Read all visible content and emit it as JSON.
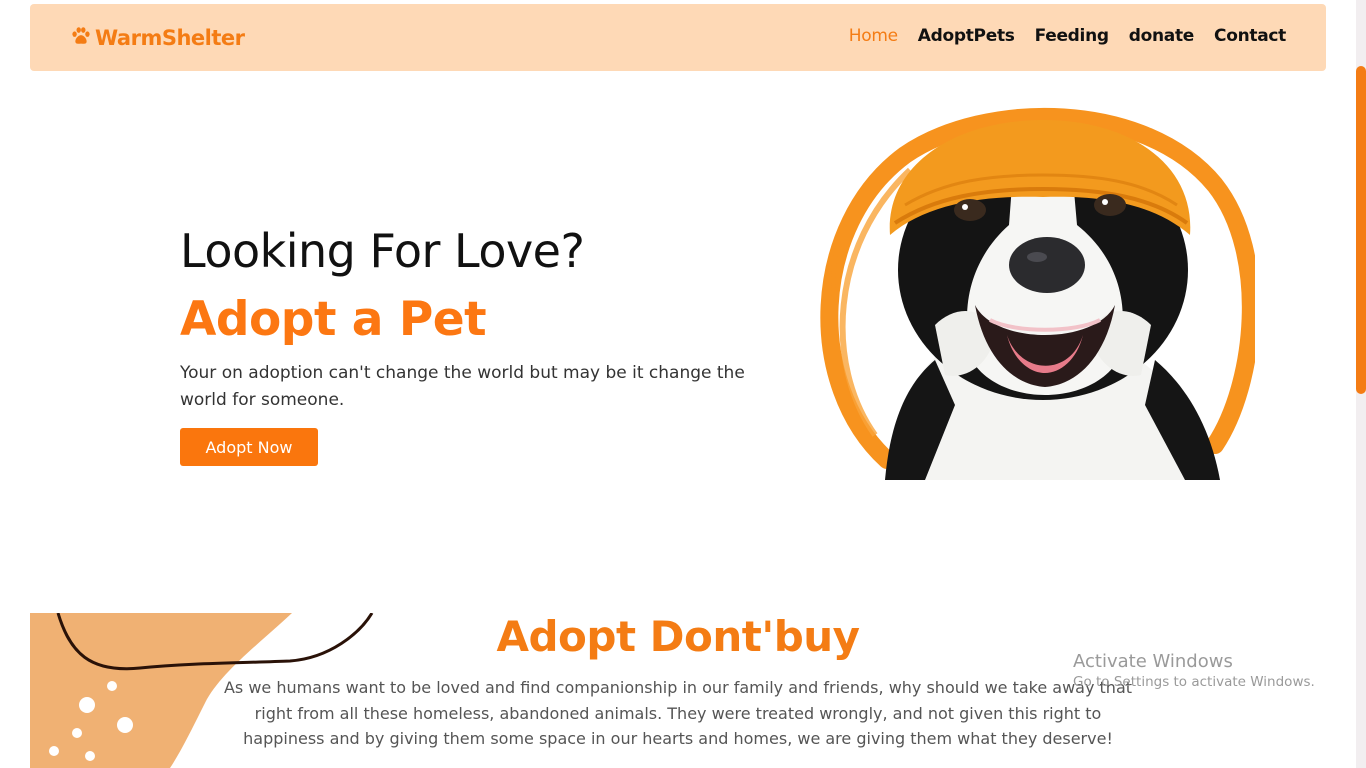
{
  "brand": {
    "name": "WarmShelter",
    "icon": "paw-icon",
    "color": "#f47c14"
  },
  "nav": {
    "items": [
      {
        "label": "Home",
        "active": true
      },
      {
        "label": "AdoptPets",
        "active": false
      },
      {
        "label": "Feeding",
        "active": false
      },
      {
        "label": "donate",
        "active": false
      },
      {
        "label": "Contact",
        "active": false
      }
    ]
  },
  "hero": {
    "title": "Looking For Love?",
    "subtitle": "Adopt a Pet",
    "description": "Your on adoption can't change the world but may be it change the world for someone.",
    "cta_label": "Adopt Now",
    "accent_color": "#fa760d"
  },
  "section": {
    "title": "Adopt Dont'buy",
    "text": "As we humans want to be loved and find companionship in our family and friends, why should we take away that right from all these homeless, abandoned animals. They were treated wrongly, and not given this right to happiness and by giving them some space in our hearts and homes, we are giving them what they deserve!"
  },
  "watermark": {
    "title": "Activate Windows",
    "subtitle": "Go to Settings to activate Windows."
  },
  "colors": {
    "nav_background": "#fed9b6",
    "accent": "#f47c14",
    "blob": "#f0b173"
  }
}
